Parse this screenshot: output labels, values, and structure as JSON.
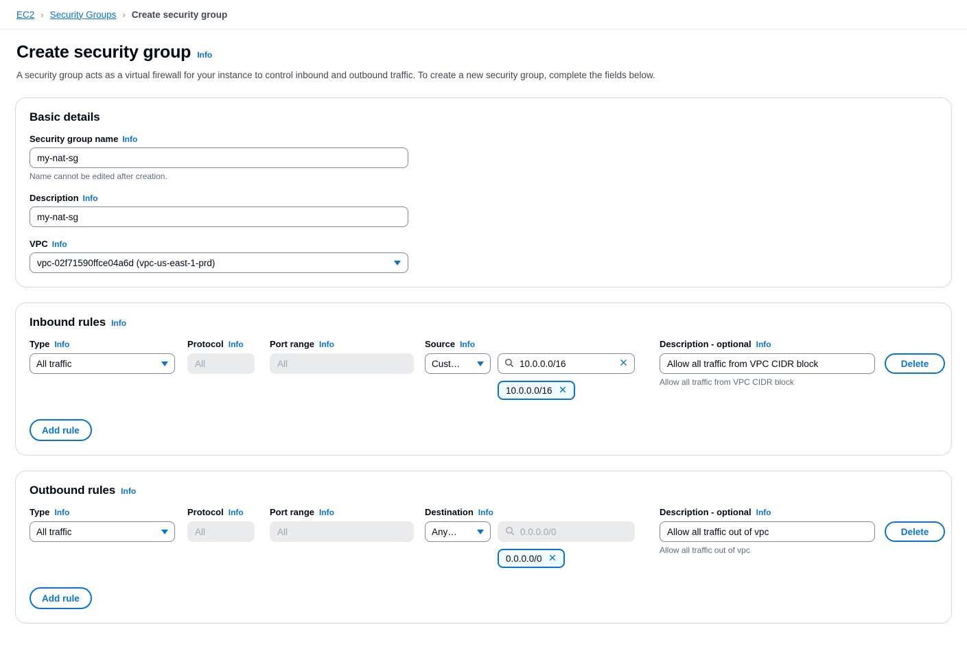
{
  "breadcrumb": {
    "items": [
      {
        "label": "EC2",
        "current": false
      },
      {
        "label": "Security Groups",
        "current": false
      },
      {
        "label": "Create security group",
        "current": true
      }
    ],
    "separator": "›"
  },
  "header": {
    "title": "Create security group",
    "info_label": "Info",
    "description": "A security group acts as a virtual firewall for your instance to control inbound and outbound traffic. To create a new security group, complete the fields below."
  },
  "basic_details": {
    "title": "Basic details",
    "info_label": "Info",
    "name_field": {
      "label": "Security group name",
      "info_label": "Info",
      "value": "my-nat-sg",
      "placeholder": "",
      "hint": "Name cannot be edited after creation."
    },
    "description_field": {
      "label": "Description",
      "info_label": "Info",
      "value": "my-nat-sg",
      "placeholder": ""
    },
    "vpc_field": {
      "label": "VPC",
      "info_label": "Info",
      "value": "vpc-02f71590ffce04a6d (vpc-us-east-1-prd)",
      "caret_icon": "chevron-down-icon"
    }
  },
  "inbound": {
    "title": "Inbound rules",
    "info_label": "Info",
    "headers": {
      "type": "Type",
      "protocol": "Protocol",
      "port_range": "Port range",
      "source": "Source",
      "description": "Description - optional",
      "info_label": "Info"
    },
    "rule": {
      "type_value": "All traffic",
      "protocol_value": "All",
      "port_range_value": "All",
      "source_type_value": "Cust…",
      "source_search_value": "10.0.0.0/16",
      "source_search_placeholder": "",
      "search_icon": "search-icon",
      "clear_icon": "close-icon",
      "token_value": "10.0.0.0/16",
      "token_remove_icon": "close-icon",
      "description_value": "Allow all traffic from VPC CIDR block",
      "description_hint": "Allow all traffic from VPC CIDR block",
      "delete_label": "Delete"
    },
    "add_rule_label": "Add rule"
  },
  "outbound": {
    "title": "Outbound rules",
    "info_label": "Info",
    "headers": {
      "type": "Type",
      "protocol": "Protocol",
      "port_range": "Port range",
      "destination": "Destination",
      "description": "Description - optional",
      "info_label": "Info"
    },
    "rule": {
      "type_value": "All traffic",
      "protocol_value": "All",
      "port_range_value": "All",
      "destination_type_value": "Any…",
      "destination_search_placeholder": "0.0.0.0/0",
      "search_icon": "search-icon",
      "token_value": "0.0.0.0/0",
      "token_remove_icon": "close-icon",
      "description_value": "Allow all traffic out of vpc",
      "description_hint": "Allow all traffic out of vpc",
      "delete_label": "Delete"
    },
    "add_rule_label": "Add rule"
  },
  "colors": {
    "accent_blue": "#0972d3",
    "text_primary": "#000811",
    "text_secondary": "#414750",
    "hint_grey": "#5f6b7a",
    "border_grey": "#7d8998",
    "card_border": "#d5dbdb",
    "disabled_bg": "#e9ebed",
    "token_bg": "#f0fbff"
  }
}
